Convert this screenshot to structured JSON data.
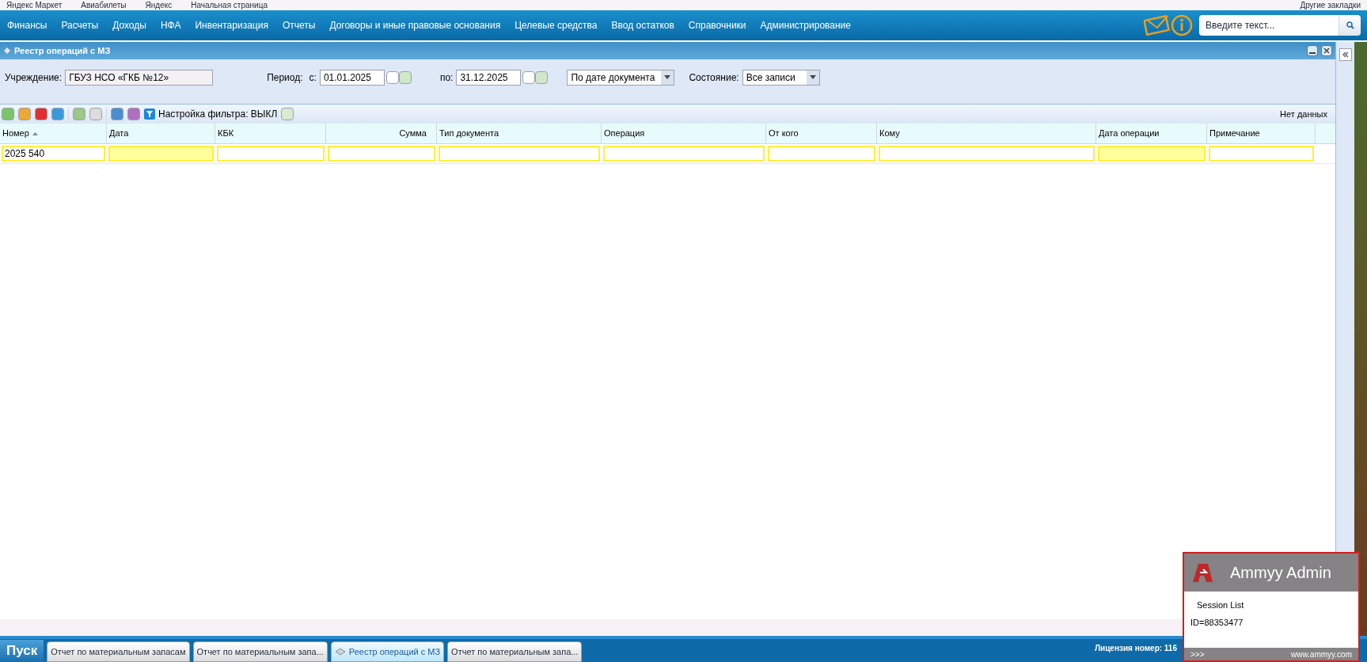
{
  "bookmarks": [
    "Яндекс Маркет",
    "Авиабилеты",
    "Яндекс",
    "Начальная страница"
  ],
  "other_bookmarks": "Другие закладки",
  "menu": [
    "Финансы",
    "Расчеты",
    "Доходы",
    "НФА",
    "Инвентаризация",
    "Отчеты",
    "Договоры и иные правовые основания",
    "Целевые средства",
    "Ввод остатков",
    "Справочники",
    "Администрирование"
  ],
  "search": {
    "placeholder": "Введите текст..."
  },
  "window": {
    "title": "Реестр операций с МЗ"
  },
  "filters": {
    "institution_label": "Учреждение:",
    "institution": "ГБУЗ НСО «ГКБ №12»",
    "period_label": "Период:",
    "from_label": "с:",
    "from": "01.01.2025",
    "to_label": "по:",
    "to": "31.12.2025",
    "date_mode": "По дате документа",
    "state_label": "Состояние:",
    "state": "Все записи"
  },
  "toolbar": {
    "filter_button": "Настройка фильтра: ВЫКЛ",
    "status": "Нет данных"
  },
  "table": {
    "columns": [
      {
        "label": "Номер",
        "sorted": true,
        "kind": "text",
        "filter": "2025 540"
      },
      {
        "label": "Дата",
        "sorted": false,
        "kind": "date"
      },
      {
        "label": "КБК",
        "sorted": false,
        "kind": "text"
      },
      {
        "label": "Сумма",
        "sorted": false,
        "kind": "amount"
      },
      {
        "label": "Тип документа",
        "sorted": false,
        "kind": "text"
      },
      {
        "label": "Операция",
        "sorted": false,
        "kind": "text"
      },
      {
        "label": "От кого",
        "sorted": false,
        "kind": "text"
      },
      {
        "label": "Кому",
        "sorted": false,
        "kind": "text"
      },
      {
        "label": "Дата операции",
        "sorted": false,
        "kind": "date"
      },
      {
        "label": "Примечание",
        "sorted": false,
        "kind": "text"
      }
    ]
  },
  "taskbar": {
    "start": "Пуск",
    "tasks": [
      {
        "label": "Отчет по материальным запасам",
        "selected": false
      },
      {
        "label": "Отчет по материальным запа...",
        "selected": false
      },
      {
        "label": "Реестр операций с МЗ",
        "selected": true
      },
      {
        "label": "Отчет по материальным запа...",
        "selected": false
      }
    ],
    "license": "Лицензия номер: 116"
  },
  "ammyy": {
    "title": "Ammyy Admin",
    "session_list": "Session List",
    "id": "ID=88353477",
    "more": ">>>",
    "site": "www.ammyy.com"
  }
}
